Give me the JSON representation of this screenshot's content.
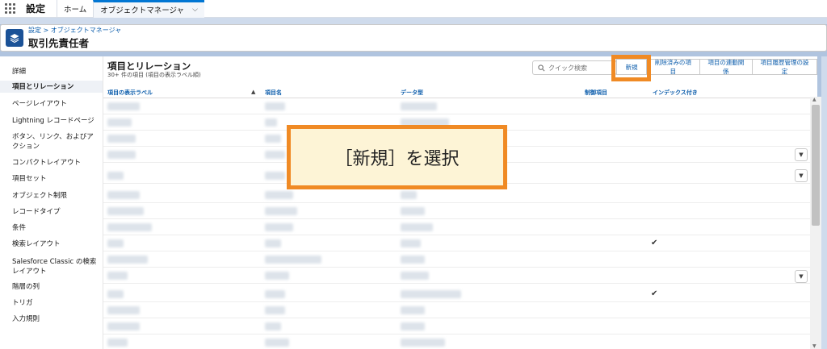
{
  "topnav": {
    "app_name": "設定",
    "tabs": [
      {
        "label": "ホーム"
      },
      {
        "label": "オブジェクトマネージャ"
      }
    ]
  },
  "header": {
    "breadcrumb": "設定 > オブジェクトマネージャ",
    "title": "取引先責任者"
  },
  "sidebar": {
    "items": [
      {
        "label": "詳細"
      },
      {
        "label": "項目とリレーション"
      },
      {
        "label": "ページレイアウト"
      },
      {
        "label": "Lightning レコードページ"
      },
      {
        "label": "ボタン、リンク、およびアクション"
      },
      {
        "label": "コンパクトレイアウト"
      },
      {
        "label": "項目セット"
      },
      {
        "label": "オブジェクト制限"
      },
      {
        "label": "レコードタイプ"
      },
      {
        "label": "条件"
      },
      {
        "label": "検索レイアウト"
      },
      {
        "label": "Salesforce Classic の検索レイアウト"
      },
      {
        "label": "階層の列"
      },
      {
        "label": "トリガ"
      },
      {
        "label": "入力規則"
      }
    ]
  },
  "main": {
    "title": "項目とリレーション",
    "subtitle": "30+ 件の項目 (項目の表示ラベル順)",
    "search_placeholder": "クイック検索",
    "buttons": {
      "new": "新規",
      "deleted": "削除済みの項目",
      "dependencies": "項目の連動関係",
      "history": "項目履歴管理の設定"
    },
    "columns": [
      "項目の表示ラベル",
      "項目名",
      "データ型",
      "制御項目",
      "インデックス付き"
    ],
    "sort_indicator": "▲"
  },
  "callout": {
    "text": "［新規］を選択"
  },
  "icons": {
    "app_launcher": "waffle-icon",
    "header": "layers-icon",
    "search": "search-icon",
    "dropdown": "chevron-down-icon",
    "check": "checkmark-icon"
  },
  "colors": {
    "brand_blue": "#0176d3",
    "link_blue": "#0b5cab",
    "header_icon": "#1b5297",
    "annotation_orange": "#f08a24",
    "callout_bg": "#fdf4d6"
  }
}
